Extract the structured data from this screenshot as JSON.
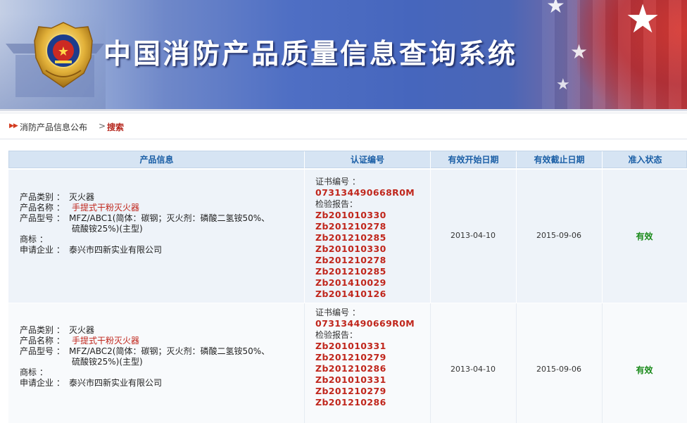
{
  "banner": {
    "title": "中国消防产品质量信息查询系统"
  },
  "breadcrumb": {
    "first": "消防产品信息公布",
    "separator": ">",
    "current": "搜索"
  },
  "table": {
    "headers": [
      "产品信息",
      "认证编号",
      "有效开始日期",
      "有效截止日期",
      "准入状态"
    ],
    "rows": [
      {
        "category_label": "产品类别 ：",
        "category": "灭火器",
        "name_label": "产品名称 ：",
        "name": "手提式干粉灭火器",
        "model_label": "产品型号 ：",
        "model_line1": "MFZ/ABC1(简体：碳钢；灭火剂：磷酸二氢铵50%、",
        "model_line2": "硫酸铵25%)(主型)",
        "brand_label": "商标 ：",
        "company_label": "申请企业 ：",
        "company": "泰兴市四新实业有限公司",
        "cert_label": "证书编号 ：",
        "cert_no": "073134490668R0M",
        "report_label": "检验报告：",
        "reports": [
          "Zb201010330",
          "Zb201210278",
          "Zb201210285",
          "Zb201010330",
          "Zb201210278",
          "Zb201210285",
          "Zb201410029",
          "Zb201410126"
        ],
        "start_date": "2013-04-10",
        "end_date": "2015-09-06",
        "status": "有效"
      },
      {
        "category_label": "产品类别 ：",
        "category": "灭火器",
        "name_label": "产品名称 ：",
        "name": "手提式干粉灭火器",
        "model_label": "产品型号 ：",
        "model_line1": "MFZ/ABC2(简体：碳钢；灭火剂：磷酸二氢铵50%、",
        "model_line2": "硫酸铵25%)(主型)",
        "brand_label": "商标 ：",
        "company_label": "申请企业 ：",
        "company": "泰兴市四新实业有限公司",
        "cert_label": "证书编号 ：",
        "cert_no": "073134490669R0M",
        "report_label": "检验报告：",
        "reports": [
          "Zb201010331",
          "Zb201210279",
          "Zb201210286",
          "Zb201010331",
          "Zb201210279",
          "Zb201210286"
        ],
        "start_date": "2013-04-10",
        "end_date": "2015-09-06",
        "status": "有效"
      }
    ]
  },
  "colors": {
    "banner_blue": "#4666bd",
    "header_bg": "#d6e4f3",
    "header_text": "#1b5fa6",
    "code_red": "#c0261c",
    "status_green": "#1a8a1a"
  }
}
